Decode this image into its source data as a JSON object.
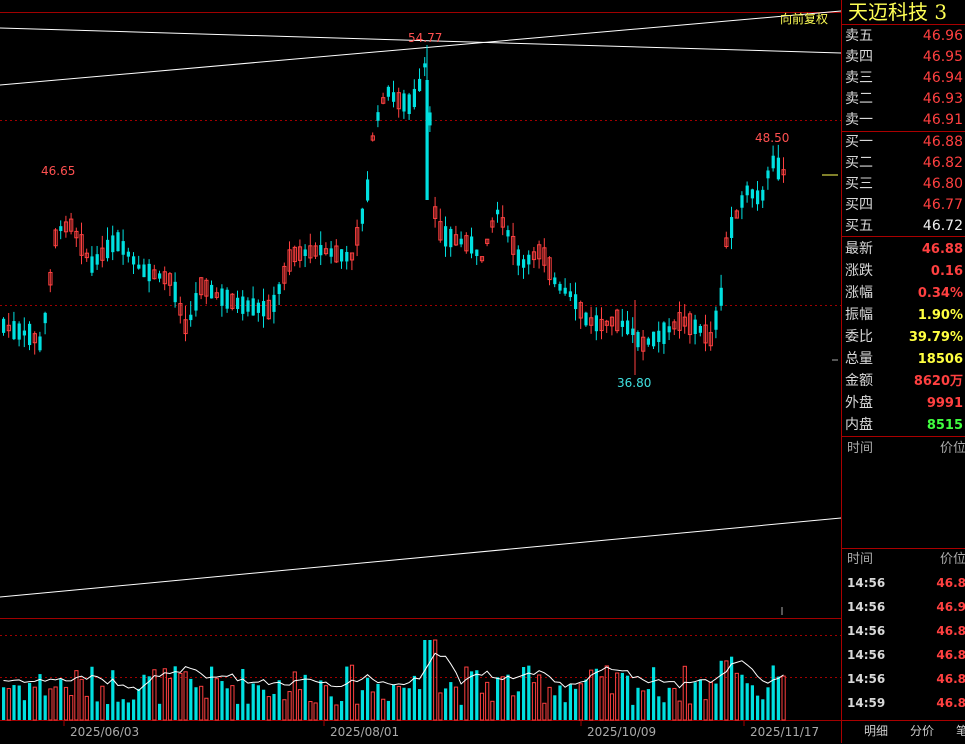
{
  "header": {
    "stock_name": "天迈科技 3",
    "adjust_button": "向前复权"
  },
  "order_book": {
    "asks": [
      {
        "label": "卖五",
        "price": "46.96"
      },
      {
        "label": "卖四",
        "price": "46.95"
      },
      {
        "label": "卖三",
        "price": "46.94"
      },
      {
        "label": "卖二",
        "price": "46.93"
      },
      {
        "label": "卖一",
        "price": "46.91"
      }
    ],
    "bids": [
      {
        "label": "买一",
        "price": "46.88"
      },
      {
        "label": "买二",
        "price": "46.82"
      },
      {
        "label": "买三",
        "price": "46.80"
      },
      {
        "label": "买四",
        "price": "46.77"
      },
      {
        "label": "买五",
        "price": "46.72"
      }
    ]
  },
  "quote": [
    {
      "label": "最新",
      "value": "46.88"
    },
    {
      "label": "涨跌",
      "value": "0.16"
    },
    {
      "label": "涨幅",
      "value": "0.34%"
    },
    {
      "label": "振幅",
      "value": "1.90%"
    },
    {
      "label": "委比",
      "value": "39.79%"
    },
    {
      "label": "总量",
      "value": "18506"
    },
    {
      "label": "金额",
      "value": "8620万"
    },
    {
      "label": "外盘",
      "value": "9991"
    },
    {
      "label": "内盘",
      "value": "8515"
    }
  ],
  "ticks_header": {
    "time": "时间",
    "price": "价位"
  },
  "ticks": [
    {
      "time": "14:56",
      "price": "46.8"
    },
    {
      "time": "14:56",
      "price": "46.9"
    },
    {
      "time": "14:56",
      "price": "46.8"
    },
    {
      "time": "14:56",
      "price": "46.8"
    },
    {
      "time": "14:56",
      "price": "46.8"
    },
    {
      "time": "14:59",
      "price": "46.8"
    }
  ],
  "tabs": [
    "明细",
    "分价",
    "笔"
  ],
  "chart_data": {
    "type": "candlestick",
    "annotations": {
      "high": "54.77",
      "left_high": "46.65",
      "low": "36.80",
      "recent_high": "48.50"
    },
    "x_tick_labels": [
      "2025/06/03",
      "2025/08/01",
      "2025/10/09",
      "2025/11/17"
    ],
    "colors": {
      "up": "#ff4040",
      "down": "#00e0e0",
      "grid": "#a00000",
      "line": "#ffffff"
    }
  }
}
